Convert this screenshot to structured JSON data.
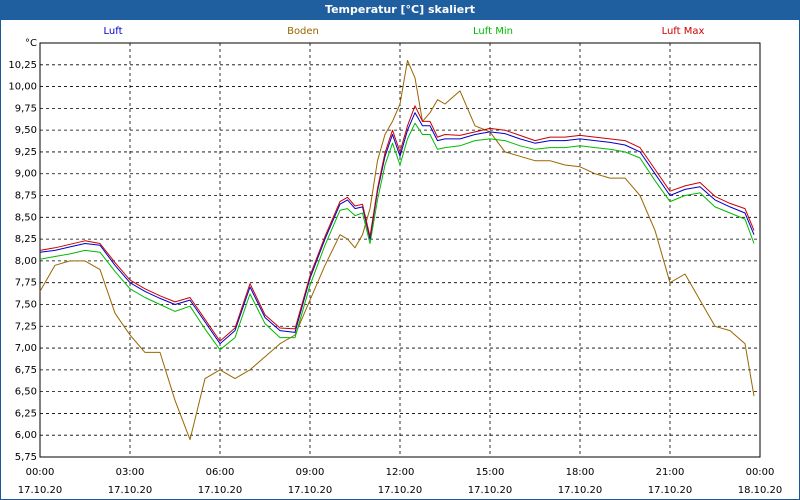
{
  "window": {
    "title": "Temperatur [°C] skaliert"
  },
  "chart_data": {
    "type": "line",
    "title": "Temperatur [°C] skaliert",
    "ylabel": "°C",
    "ylim": [
      5.75,
      10.5
    ],
    "yticks": [
      5.75,
      6.0,
      6.25,
      6.5,
      6.75,
      7.0,
      7.25,
      7.5,
      7.75,
      8.0,
      8.25,
      8.5,
      8.75,
      9.0,
      9.25,
      9.5,
      9.75,
      10.0,
      10.25
    ],
    "yticklabels": [
      "5,75",
      "6,00",
      "6,25",
      "6,50",
      "6,75",
      "7,00",
      "7,25",
      "7,50",
      "7,75",
      "8,00",
      "8,25",
      "8,50",
      "8,75",
      "9,00",
      "9,25",
      "9,50",
      "9,75",
      "10,00",
      "10,25"
    ],
    "xlim": [
      0,
      24
    ],
    "xticks": [
      0,
      3,
      6,
      9,
      12,
      15,
      18,
      21,
      24
    ],
    "xticklabels": [
      {
        "time": "00:00",
        "date": "17.10.20"
      },
      {
        "time": "03:00",
        "date": "17.10.20"
      },
      {
        "time": "06:00",
        "date": "17.10.20"
      },
      {
        "time": "09:00",
        "date": "17.10.20"
      },
      {
        "time": "12:00",
        "date": "17.10.20"
      },
      {
        "time": "15:00",
        "date": "17.10.20"
      },
      {
        "time": "18:00",
        "date": "17.10.20"
      },
      {
        "time": "21:00",
        "date": "17.10.20"
      },
      {
        "time": "00:00",
        "date": "18.10.20"
      }
    ],
    "grid": true,
    "legend_position": "top",
    "x": [
      0,
      0.5,
      1,
      1.5,
      2,
      2.5,
      3,
      3.5,
      4,
      4.5,
      5,
      5.5,
      6,
      6.5,
      7,
      7.5,
      8,
      8.5,
      9,
      9.5,
      10,
      10.25,
      10.5,
      10.75,
      11,
      11.25,
      11.5,
      11.75,
      12,
      12.25,
      12.5,
      12.75,
      13,
      13.25,
      13.5,
      14,
      14.5,
      15,
      15.5,
      16,
      16.5,
      17,
      17.5,
      18,
      18.5,
      19,
      19.5,
      20,
      20.5,
      21,
      21.5,
      22,
      22.5,
      23,
      23.5,
      23.8
    ],
    "series": [
      {
        "name": "Luft",
        "color": "#0000cc",
        "values": [
          8.1,
          8.12,
          8.16,
          8.2,
          8.18,
          7.95,
          7.75,
          7.65,
          7.57,
          7.5,
          7.55,
          7.3,
          7.05,
          7.2,
          7.7,
          7.35,
          7.2,
          7.18,
          7.8,
          8.25,
          8.65,
          8.7,
          8.6,
          8.62,
          8.25,
          8.8,
          9.2,
          9.45,
          9.2,
          9.5,
          9.7,
          9.55,
          9.55,
          9.38,
          9.4,
          9.4,
          9.45,
          9.48,
          9.46,
          9.4,
          9.35,
          9.38,
          9.38,
          9.4,
          9.38,
          9.36,
          9.33,
          9.25,
          9.0,
          8.75,
          8.82,
          8.85,
          8.7,
          8.62,
          8.55,
          8.3
        ]
      },
      {
        "name": "Boden",
        "color": "#996600",
        "values": [
          7.65,
          7.95,
          8.0,
          8.0,
          7.9,
          7.4,
          7.15,
          6.95,
          6.95,
          6.4,
          5.95,
          6.65,
          6.75,
          6.65,
          6.75,
          6.9,
          7.05,
          7.15,
          7.55,
          7.95,
          8.3,
          8.25,
          8.15,
          8.3,
          8.6,
          9.15,
          9.45,
          9.6,
          9.8,
          10.3,
          10.1,
          9.6,
          9.7,
          9.85,
          9.8,
          9.95,
          9.55,
          9.48,
          9.25,
          9.2,
          9.15,
          9.15,
          9.1,
          9.08,
          9.0,
          8.95,
          8.95,
          8.75,
          8.35,
          7.75,
          7.85,
          7.55,
          7.25,
          7.2,
          7.05,
          6.45
        ]
      },
      {
        "name": "Luft Min",
        "color": "#00bb00",
        "values": [
          8.02,
          8.05,
          8.08,
          8.12,
          8.1,
          7.88,
          7.68,
          7.58,
          7.5,
          7.42,
          7.48,
          7.22,
          6.98,
          7.12,
          7.62,
          7.28,
          7.12,
          7.12,
          7.72,
          8.18,
          8.58,
          8.6,
          8.52,
          8.55,
          8.2,
          8.7,
          9.1,
          9.35,
          9.1,
          9.4,
          9.58,
          9.45,
          9.45,
          9.28,
          9.3,
          9.32,
          9.38,
          9.4,
          9.38,
          9.32,
          9.28,
          9.3,
          9.3,
          9.32,
          9.3,
          9.28,
          9.25,
          9.18,
          8.92,
          8.68,
          8.75,
          8.78,
          8.62,
          8.55,
          8.48,
          8.2
        ]
      },
      {
        "name": "Luft Max",
        "color": "#cc0000",
        "values": [
          8.12,
          8.15,
          8.19,
          8.23,
          8.2,
          7.98,
          7.78,
          7.68,
          7.6,
          7.53,
          7.58,
          7.33,
          7.08,
          7.23,
          7.74,
          7.38,
          7.23,
          7.22,
          7.83,
          8.28,
          8.68,
          8.73,
          8.63,
          8.65,
          8.28,
          8.83,
          9.24,
          9.5,
          9.25,
          9.55,
          9.78,
          9.6,
          9.6,
          9.42,
          9.45,
          9.44,
          9.48,
          9.52,
          9.5,
          9.44,
          9.38,
          9.42,
          9.42,
          9.44,
          9.42,
          9.4,
          9.38,
          9.3,
          9.05,
          8.8,
          8.86,
          8.9,
          8.74,
          8.66,
          8.6,
          8.35
        ]
      }
    ]
  }
}
